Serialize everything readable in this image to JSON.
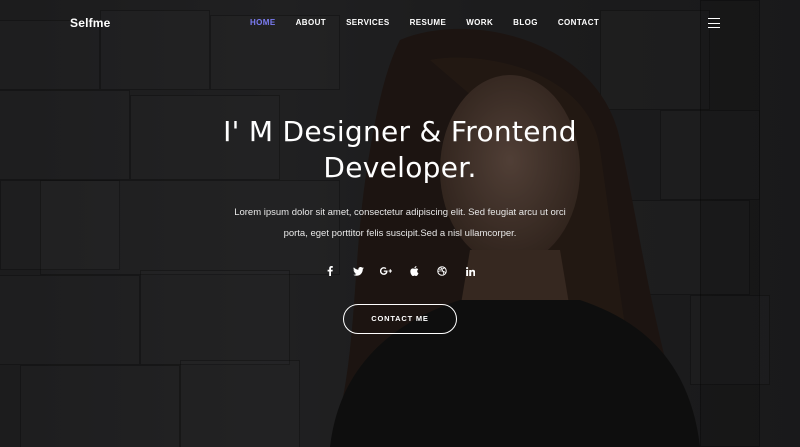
{
  "brand": "Selfme",
  "nav": {
    "items": [
      {
        "label": "HOME",
        "active": true
      },
      {
        "label": "ABOUT"
      },
      {
        "label": "SERVICES"
      },
      {
        "label": "RESUME"
      },
      {
        "label": "WORK"
      },
      {
        "label": "BLOG"
      },
      {
        "label": "CONTACT"
      }
    ],
    "menu_icon": "hamburger-icon",
    "active_color": "#7b7cf3"
  },
  "hero": {
    "title_line1": "I' M Designer & Frontend",
    "title_line2": "Developer.",
    "description_line1": "Lorem ipsum dolor sit amet, consectetur adipiscing elit. Sed feugiat arcu ut orci",
    "description_line2": "porta, eget porttitor felis suscipit.Sed a nisl ullamcorper.",
    "social": [
      {
        "icon": "facebook-icon",
        "glyph": "f"
      },
      {
        "icon": "twitter-icon",
        "glyph": "t"
      },
      {
        "icon": "google-plus-icon",
        "glyph": "G+"
      },
      {
        "icon": "apple-icon",
        "glyph": "apple"
      },
      {
        "icon": "dribbble-icon",
        "glyph": "dribbble"
      },
      {
        "icon": "linkedin-icon",
        "glyph": "in"
      }
    ],
    "cta_label": "CONTACT ME"
  }
}
